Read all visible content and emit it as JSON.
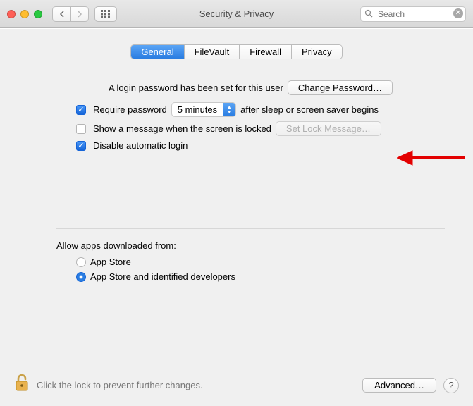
{
  "window": {
    "title": "Security & Privacy",
    "search_placeholder": "Search"
  },
  "tabs": {
    "general": "General",
    "filevault": "FileVault",
    "firewall": "Firewall",
    "privacy": "Privacy"
  },
  "login": {
    "intro": "A login password has been set for this user",
    "change_password": "Change Password…",
    "require_password": "Require password",
    "delay_value": "5 minutes",
    "after_sleep": "after sleep or screen saver begins",
    "show_message": "Show a message when the screen is locked",
    "set_lock_message": "Set Lock Message…",
    "disable_auto_login": "Disable automatic login"
  },
  "gatekeeper": {
    "heading": "Allow apps downloaded from:",
    "app_store": "App Store",
    "app_store_identified": "App Store and identified developers"
  },
  "footer": {
    "lock_text": "Click the lock to prevent further changes.",
    "advanced": "Advanced…",
    "help": "?"
  }
}
